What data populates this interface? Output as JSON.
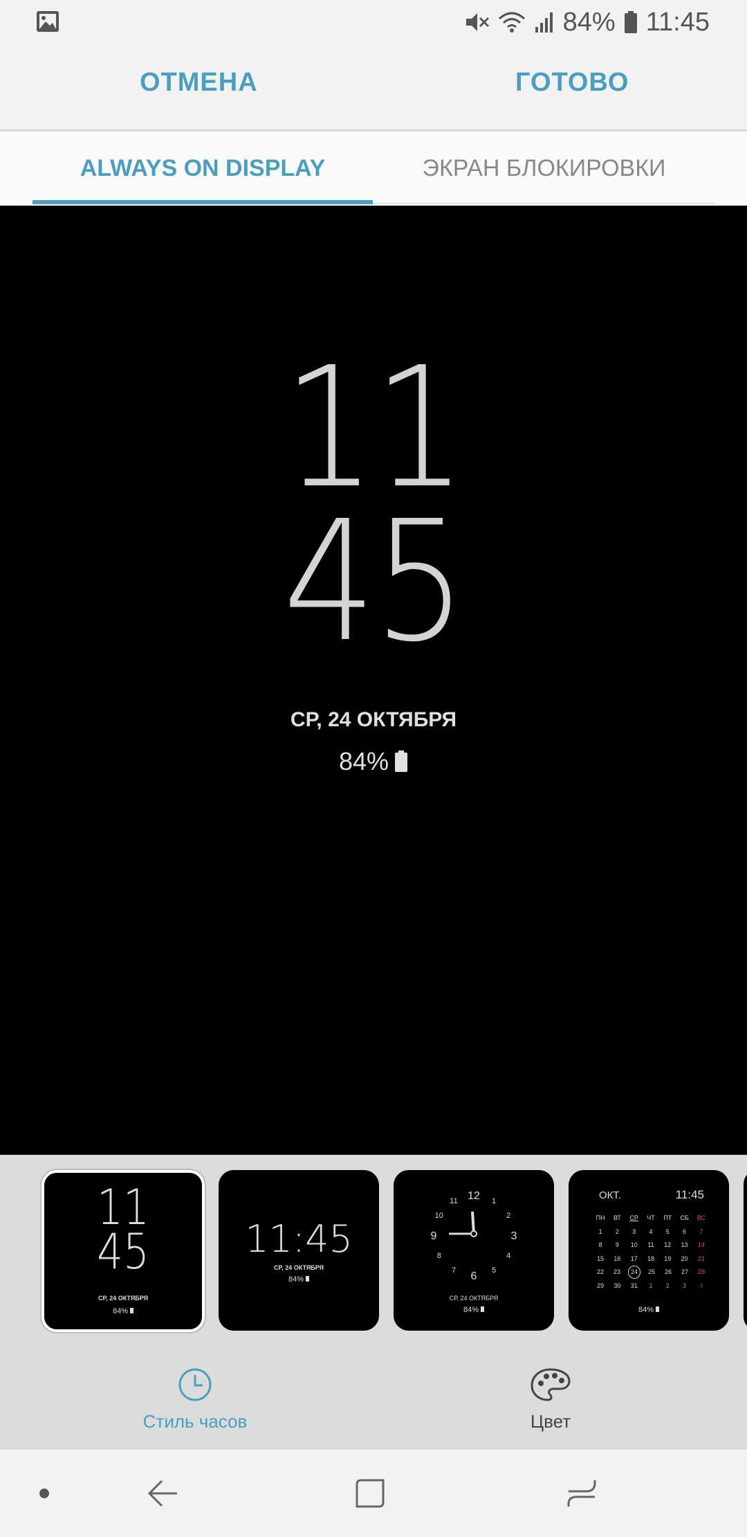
{
  "status_bar": {
    "battery_percent": "84%",
    "time": "11:45",
    "icons": [
      "gallery-icon",
      "mute-icon",
      "wifi-icon",
      "signal-icon",
      "battery-icon"
    ]
  },
  "header": {
    "cancel_label": "ОТМЕНА",
    "done_label": "ГОТОВО"
  },
  "tabs": [
    {
      "label": "ALWAYS ON DISPLAY",
      "active": true
    },
    {
      "label": "ЭКРАН БЛОКИРОВКИ",
      "active": false
    }
  ],
  "preview": {
    "hour": "11",
    "minute": "45",
    "date": "СР, 24 ОКТЯБРЯ",
    "battery": "84%"
  },
  "thumbnails": {
    "t1": {
      "hour": "11",
      "minute": "45",
      "date": "СР, 24 ОКТЯБРЯ",
      "battery": "84%",
      "selected": true
    },
    "t2": {
      "time": "11:45",
      "date": "СР, 24 ОКТЯБРЯ",
      "battery": "84%"
    },
    "t3": {
      "numbers": [
        "12",
        "1",
        "2",
        "3",
        "4",
        "5",
        "6",
        "7",
        "8",
        "9",
        "10",
        "11"
      ],
      "date": "СР, 24 ОКТЯБРЯ",
      "battery": "84%"
    },
    "t4": {
      "month": "ОКТ.",
      "time": "11:45",
      "weekdays": [
        "ПН",
        "ВТ",
        "СР",
        "ЧТ",
        "ПТ",
        "СБ",
        "ВС"
      ],
      "weeks": [
        [
          "1",
          "2",
          "3",
          "4",
          "5",
          "6",
          "7"
        ],
        [
          "8",
          "9",
          "10",
          "11",
          "12",
          "13",
          "14"
        ],
        [
          "15",
          "16",
          "17",
          "18",
          "19",
          "20",
          "21"
        ],
        [
          "22",
          "23",
          "24",
          "25",
          "26",
          "27",
          "28"
        ],
        [
          "29",
          "30",
          "31",
          "1",
          "2",
          "3",
          "4"
        ]
      ],
      "today": "24",
      "battery": "84%"
    }
  },
  "options": {
    "clock_style_label": "Стиль часов",
    "color_label": "Цвет"
  },
  "colors": {
    "accent": "#4a9fc0",
    "sunday": "#e05050",
    "preview_bg": "#000000"
  }
}
